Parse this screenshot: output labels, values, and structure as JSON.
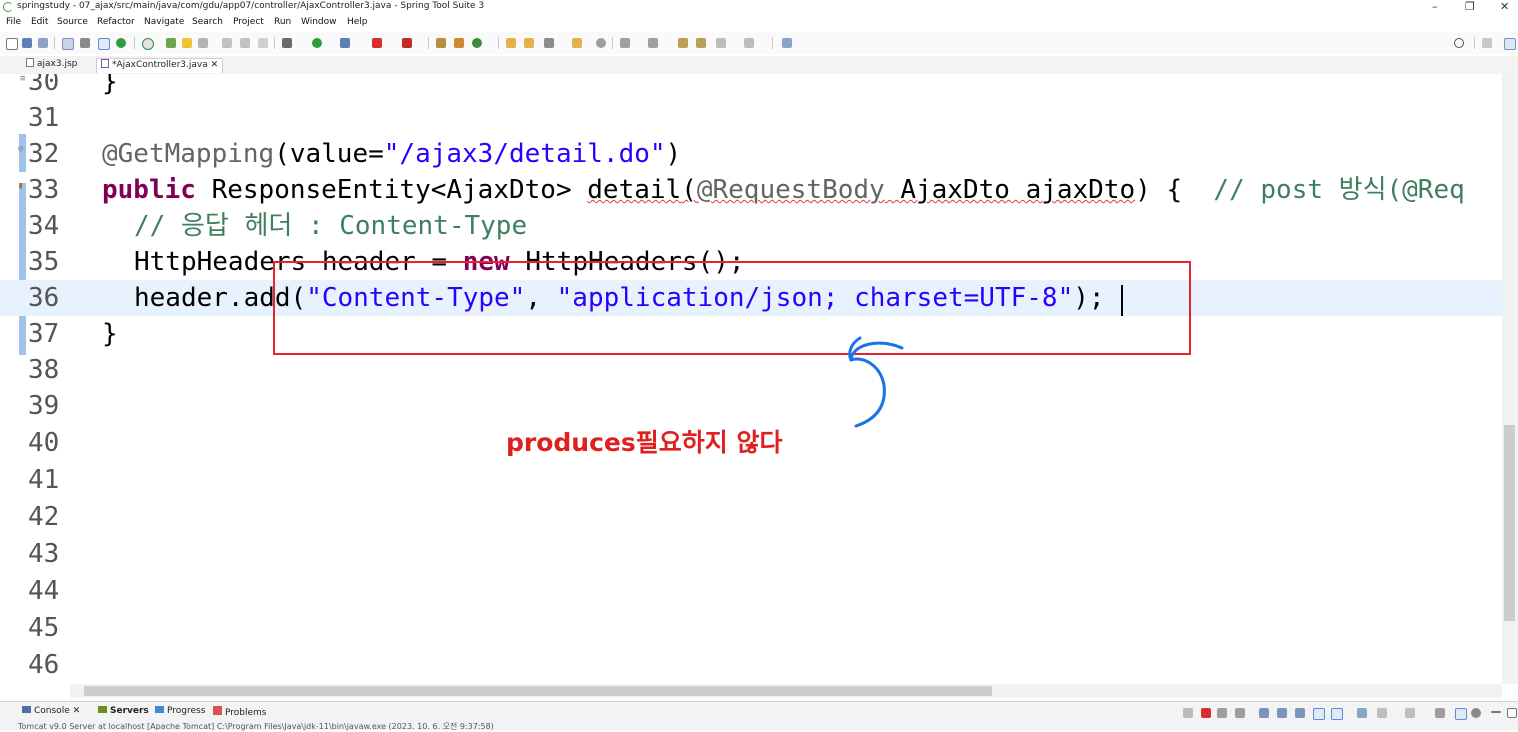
{
  "window": {
    "title": "springstudy - 07_ajax/src/main/java/com/gdu/app07/controller/AjaxController3.java - Spring Tool Suite 3",
    "minimize": "–",
    "maximize": "❐",
    "close": "✕"
  },
  "menu": [
    "File",
    "Edit",
    "Source",
    "Refactor",
    "Navigate",
    "Search",
    "Project",
    "Run",
    "Window",
    "Help"
  ],
  "tabs": [
    {
      "label": "ajax3.jsp"
    },
    {
      "label": "*AjaxController3.java",
      "close": "✕"
    }
  ],
  "editor": {
    "lines": [
      {
        "num": "30",
        "code": "}"
      },
      {
        "num": "31",
        "code": ""
      },
      {
        "num": "32",
        "annotation": "@GetMapping",
        "rest": "(value=",
        "str": "\"/ajax3/detail.do\"",
        "end": ")"
      },
      {
        "num": "33",
        "kw": "public",
        "type": " ResponseEntity<AjaxDto> ",
        "method": "detail",
        "p1": "(",
        "param_an": "@RequestBody",
        "param": " AjaxDto ajaxDto",
        "close": ") {  ",
        "comment": "// post 방식(@Req"
      },
      {
        "num": "34",
        "comment": "// 응답 헤더 : Content-Type"
      },
      {
        "num": "35",
        "a": "HttpHeaders header = ",
        "kw": "new",
        "b": " HttpHeaders();"
      },
      {
        "num": "36",
        "a": "header.add(",
        "s1": "\"Content-Type\"",
        "comma": ", ",
        "s2": "\"application/json; charset=UTF-8\"",
        "end": ");"
      },
      {
        "num": "37",
        "code": "}"
      },
      {
        "num": "38"
      },
      {
        "num": "39"
      },
      {
        "num": "40"
      },
      {
        "num": "41"
      },
      {
        "num": "42"
      },
      {
        "num": "43"
      },
      {
        "num": "44"
      },
      {
        "num": "45"
      },
      {
        "num": "46"
      }
    ]
  },
  "annotation_note": "produces필요하지 않다",
  "colors": {
    "highlight_box": "#e6232e",
    "note_text": "#e01f1f",
    "arrow": "#1a73e8"
  },
  "bottom_panel": {
    "tabs": [
      "Console",
      "Servers",
      "Progress",
      "Problems"
    ],
    "status": "Tomcat v9.0 Server at localhost [Apache Tomcat] C:\\Program Files\\Java\\jdk-11\\bin\\javaw.exe  (2023. 10. 6. 오전 9:37:58)"
  }
}
